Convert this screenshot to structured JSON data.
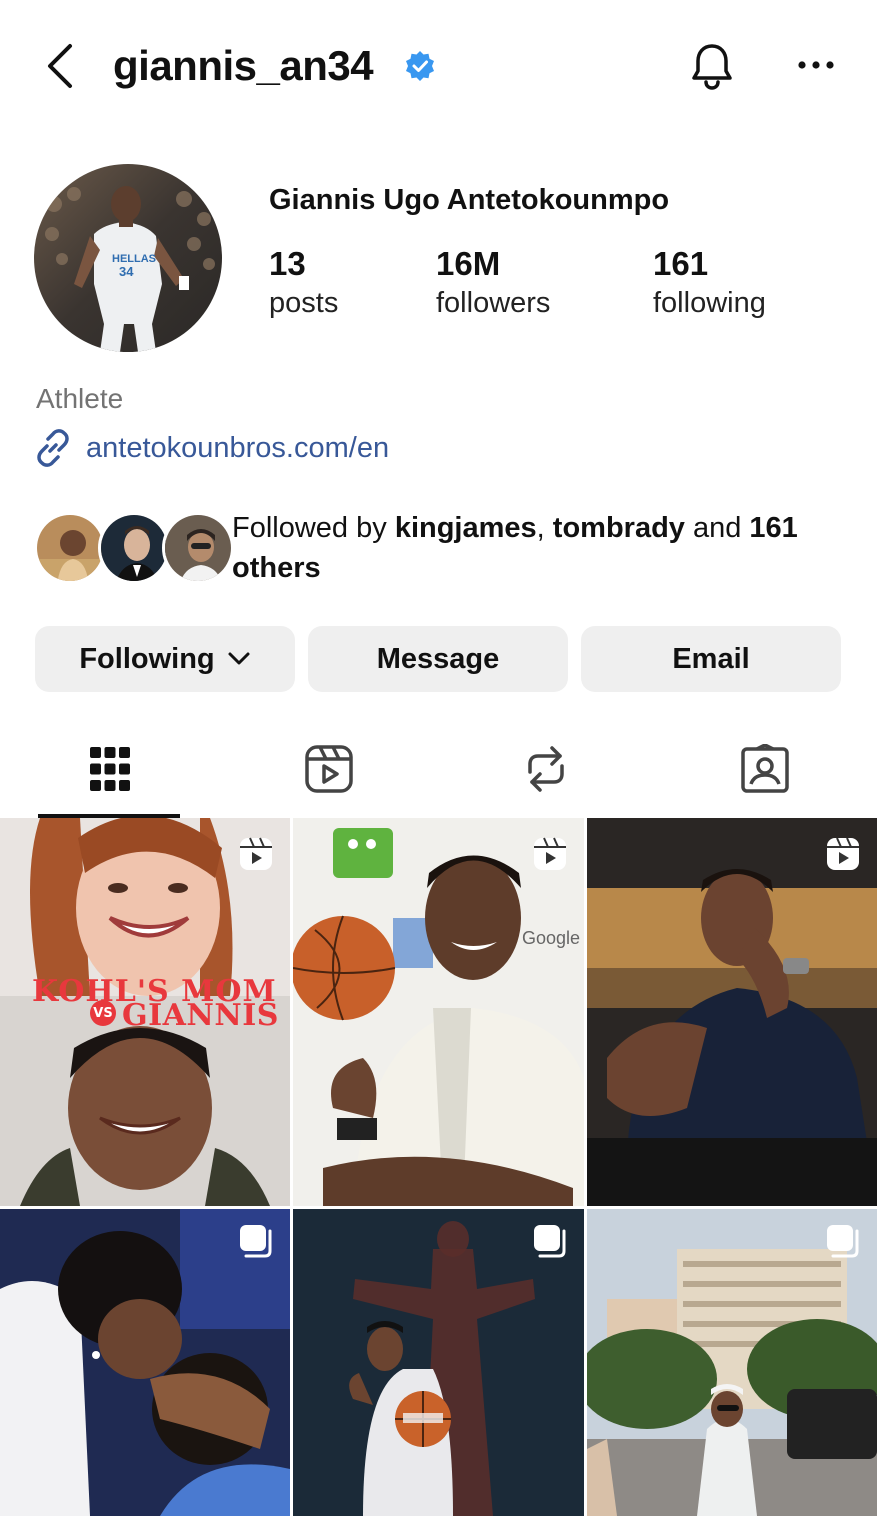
{
  "header": {
    "username": "giannis_an34"
  },
  "profile": {
    "full_name": "Giannis Ugo Antetokounmpo",
    "stats": [
      {
        "value": "13",
        "label": "posts"
      },
      {
        "value": "16M",
        "label": "followers"
      },
      {
        "value": "161",
        "label": "following"
      }
    ],
    "category": "Athlete",
    "link": "antetokounbros.com/en",
    "followed_by": {
      "prefix": "Followed by ",
      "user1": "kingjames",
      "separator": ", ",
      "user2": "tombrady",
      "middle": " and ",
      "count": "161",
      "line2": "others"
    }
  },
  "buttons": {
    "following": "Following",
    "message": "Message",
    "email": "Email"
  },
  "tabs": [
    {
      "icon": "grid-icon",
      "active": true
    },
    {
      "icon": "reels-icon",
      "active": false
    },
    {
      "icon": "reposts-icon",
      "active": false
    },
    {
      "icon": "tagged-icon",
      "active": false
    }
  ],
  "posts": [
    {
      "type": "reel",
      "overlay_line1": "KOHL'S MOM",
      "overlay_vs": "VS",
      "overlay_line2": "GIANNIS"
    },
    {
      "type": "reel",
      "overlay_text": "Google"
    },
    {
      "type": "reel"
    },
    {
      "type": "carousel"
    },
    {
      "type": "carousel"
    },
    {
      "type": "carousel"
    }
  ],
  "colors": {
    "accent_link": "#385898",
    "verified": "#3897f0",
    "button_bg": "#efefef",
    "overlay_red": "#e8383d"
  }
}
